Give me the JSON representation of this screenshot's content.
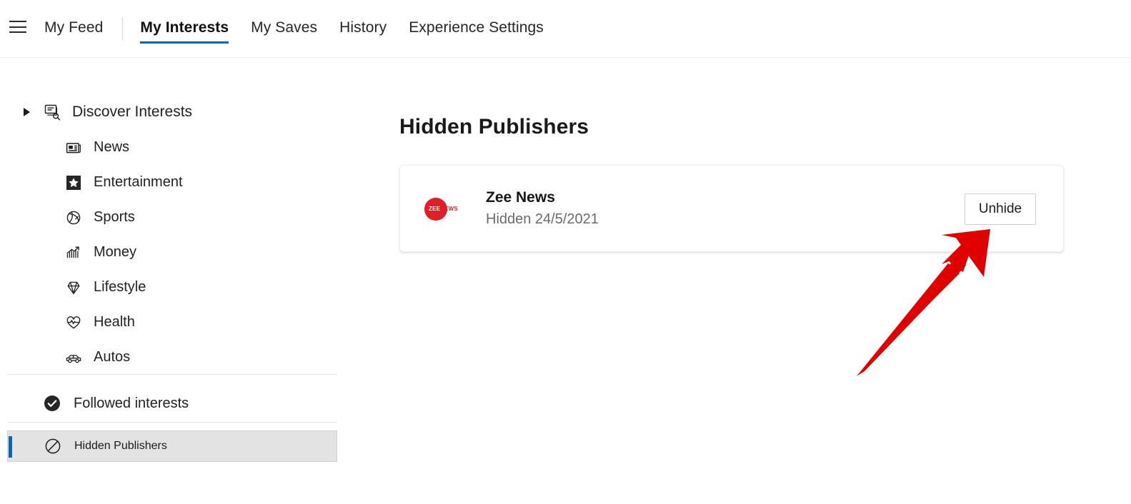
{
  "accent_color": "#0d66a8",
  "header": {
    "menu_icon": "hamburger-icon",
    "tabs": [
      {
        "label": "My Feed",
        "active": false
      },
      {
        "label": "My Interests",
        "active": true
      },
      {
        "label": "My Saves",
        "active": false
      },
      {
        "label": "History",
        "active": false
      },
      {
        "label": "Experience Settings",
        "active": false
      }
    ]
  },
  "sidebar": {
    "discover": {
      "label": "Discover Interests",
      "icon": "discover-interests-icon",
      "expanded": false
    },
    "categories": [
      {
        "label": "News",
        "icon": "news-icon"
      },
      {
        "label": "Entertainment",
        "icon": "entertainment-star-icon"
      },
      {
        "label": "Sports",
        "icon": "sports-ball-icon"
      },
      {
        "label": "Money",
        "icon": "money-chart-icon"
      },
      {
        "label": "Lifestyle",
        "icon": "lifestyle-diamond-icon"
      },
      {
        "label": "Health",
        "icon": "health-heart-icon"
      },
      {
        "label": "Autos",
        "icon": "autos-car-icon"
      }
    ],
    "followed": {
      "label": "Followed interests",
      "icon": "check-circle-icon"
    },
    "hidden": {
      "label": "Hidden Publishers",
      "icon": "block-circle-icon",
      "selected": true
    }
  },
  "main": {
    "title": "Hidden Publishers",
    "publishers": [
      {
        "name": "Zee News",
        "hidden_on": "Hidden 24/5/2021",
        "logo": {
          "text_primary": "ZEE",
          "text_secondary": "NEWS",
          "circle_color": "#e01e26"
        },
        "action_label": "Unhide"
      }
    ]
  },
  "annotation": {
    "arrow_color": "#e00000",
    "points_to": "Unhide"
  }
}
